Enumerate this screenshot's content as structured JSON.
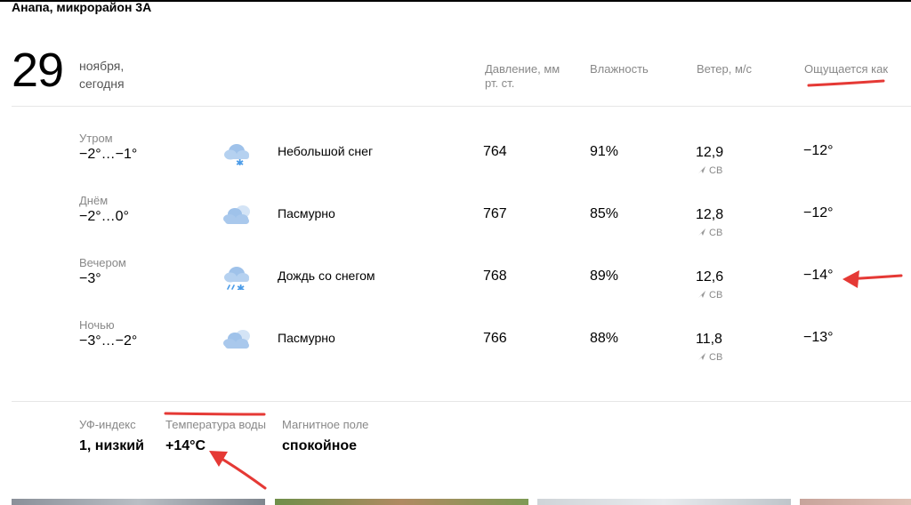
{
  "location": "Анапа, микрорайон 3А",
  "date": {
    "day": "29",
    "label": "ноября, сегодня"
  },
  "headers": {
    "pressure": "Давление, мм рт. ст.",
    "humidity": "Влажность",
    "wind": "Ветер, м/с",
    "feels_like": "Ощущается как"
  },
  "rows": [
    {
      "part": "Утром",
      "temp": "−2°…−1°",
      "icon": "light-snow-icon",
      "condition": "Небольшой снег",
      "pressure": "764",
      "humidity": "91%",
      "wind_speed": "12,9",
      "wind_dir": "СВ",
      "feels_like": "−12°"
    },
    {
      "part": "Днём",
      "temp": "−2°…0°",
      "icon": "overcast-icon",
      "condition": "Пасмурно",
      "pressure": "767",
      "humidity": "85%",
      "wind_speed": "12,8",
      "wind_dir": "СВ",
      "feels_like": "−12°"
    },
    {
      "part": "Вечером",
      "temp": "−3°",
      "icon": "sleet-icon",
      "condition": "Дождь со снегом",
      "pressure": "768",
      "humidity": "89%",
      "wind_speed": "12,6",
      "wind_dir": "СВ",
      "feels_like": "−14°"
    },
    {
      "part": "Ночью",
      "temp": "−3°…−2°",
      "icon": "overcast-icon",
      "condition": "Пасмурно",
      "pressure": "766",
      "humidity": "88%",
      "wind_speed": "11,8",
      "wind_dir": "СВ",
      "feels_like": "−13°"
    }
  ],
  "extras": {
    "uv": {
      "label": "УФ-индекс",
      "value": "1, низкий"
    },
    "water": {
      "label": "Температура воды",
      "value": "+14°C"
    },
    "magnetic": {
      "label": "Магнитное поле",
      "value": "спокойное"
    }
  },
  "colors": {
    "annotation": "#e53935",
    "cloud": "#a9c8ec",
    "snow": "#4a9be8",
    "muted": "#888888"
  }
}
